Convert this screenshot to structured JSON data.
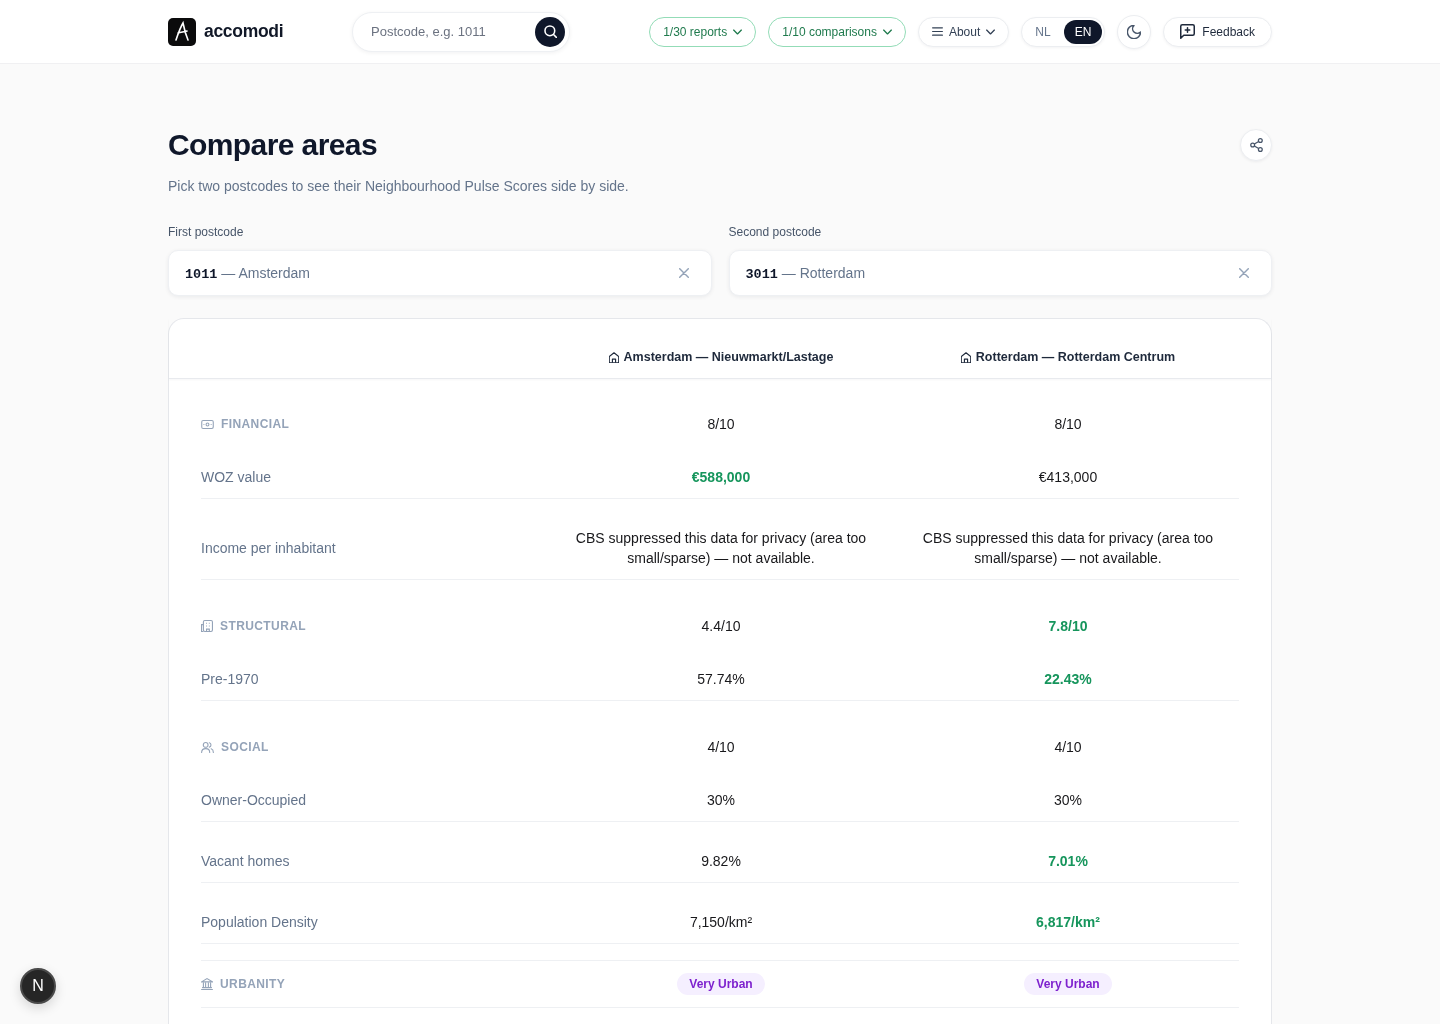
{
  "header": {
    "brand": "accomodi",
    "search": {
      "placeholder": "Postcode, e.g. 1011"
    },
    "usage": [
      {
        "label": "1/30 reports"
      },
      {
        "label": "1/10 comparisons"
      }
    ],
    "about": {
      "label": "About"
    },
    "languages": [
      {
        "label": "NL",
        "selected": false
      },
      {
        "label": "EN",
        "selected": true
      }
    ],
    "feedback": {
      "label": "Feedback"
    }
  },
  "page": {
    "title": "Compare areas",
    "subtitle": "Pick two postcodes to see their Neighbourhood Pulse Scores side by side."
  },
  "postcodes": [
    {
      "label": "First postcode",
      "code": "1011",
      "place": "— Amsterdam"
    },
    {
      "label": "Second postcode",
      "code": "3011",
      "place": "— Rotterdam"
    }
  ],
  "comparison": {
    "columns": [
      {
        "label": "Amsterdam — Nieuwmarkt/Lastage"
      },
      {
        "label": "Rotterdam — Rotterdam Centrum"
      }
    ],
    "sections": [
      {
        "kind": "financial",
        "title": "FINANCIAL",
        "scores": [
          {
            "text": "8/10",
            "highlighted": false
          },
          {
            "text": "8/10",
            "highlighted": false
          }
        ],
        "rows": [
          {
            "label": "WOZ value",
            "values": [
              {
                "text": "€588,000",
                "highlighted": true
              },
              {
                "text": "€413,000",
                "highlighted": false
              }
            ]
          },
          {
            "label": "Income per inhabitant",
            "values": [
              {
                "text": "CBS suppressed this data for privacy (area too small/sparse) — not available.",
                "highlighted": false
              },
              {
                "text": "CBS suppressed this data for privacy (area too small/sparse) — not available.",
                "highlighted": false
              }
            ]
          }
        ]
      },
      {
        "kind": "structural",
        "title": "STRUCTURAL",
        "scores": [
          {
            "text": "4.4/10",
            "highlighted": false
          },
          {
            "text": "7.8/10",
            "highlighted": true
          }
        ],
        "rows": [
          {
            "label": "Pre-1970",
            "values": [
              {
                "text": "57.74%",
                "highlighted": false
              },
              {
                "text": "22.43%",
                "highlighted": true
              }
            ]
          }
        ]
      },
      {
        "kind": "social",
        "title": "SOCIAL",
        "scores": [
          {
            "text": "4/10",
            "highlighted": false
          },
          {
            "text": "4/10",
            "highlighted": false
          }
        ],
        "rows": [
          {
            "label": "Owner-Occupied",
            "values": [
              {
                "text": "30%",
                "highlighted": false
              },
              {
                "text": "30%",
                "highlighted": false
              }
            ]
          },
          {
            "label": "Vacant homes",
            "values": [
              {
                "text": "9.82%",
                "highlighted": false
              },
              {
                "text": "7.01%",
                "highlighted": true
              }
            ]
          },
          {
            "label": "Population Density",
            "values": [
              {
                "text": "7,150/km²",
                "highlighted": false
              },
              {
                "text": "6,817/km²",
                "highlighted": true
              }
            ]
          }
        ]
      },
      {
        "kind": "urbanity",
        "title": "URBANITY",
        "badges": [
          {
            "text": "Very Urban"
          },
          {
            "text": "Very Urban"
          }
        ]
      }
    ]
  },
  "dev_badge": {
    "label": "N"
  }
}
